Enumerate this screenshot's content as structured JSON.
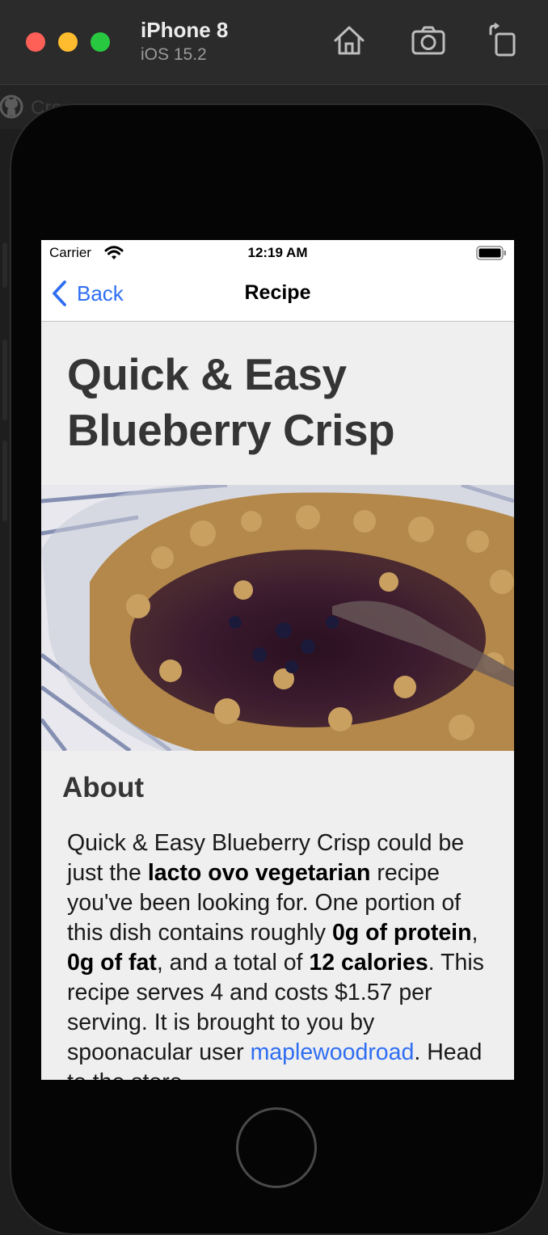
{
  "simulator": {
    "device_name": "iPhone 8",
    "os_version": "iOS 15.2",
    "background_window_text": "Cre"
  },
  "status_bar": {
    "carrier": "Carrier",
    "time": "12:19 AM"
  },
  "nav_bar": {
    "back_label": "Back",
    "title": "Recipe"
  },
  "recipe": {
    "title_line1": "Quick & Easy",
    "title_line2": "Blueberry Crisp",
    "about_heading": "About",
    "summary": {
      "t1": "Quick & Easy Blueberry Crisp could be just the ",
      "b1": "lacto ovo vegetarian",
      "t2": " recipe you've been looking for. One portion of this dish contains roughly ",
      "b2": "0g of protein",
      "t3": ", ",
      "b3": "0g of fat",
      "t4": ", and a total of ",
      "b4": "12 calories",
      "t5": ". This recipe serves 4 and costs $1.57 per serving. It is brought to you by spoonacular user ",
      "link": "maplewoodroad",
      "t6": ". Head to the store"
    }
  },
  "colors": {
    "accent": "#2f6ef2",
    "screen_background": "#efefef",
    "heading_text": "#353535"
  }
}
